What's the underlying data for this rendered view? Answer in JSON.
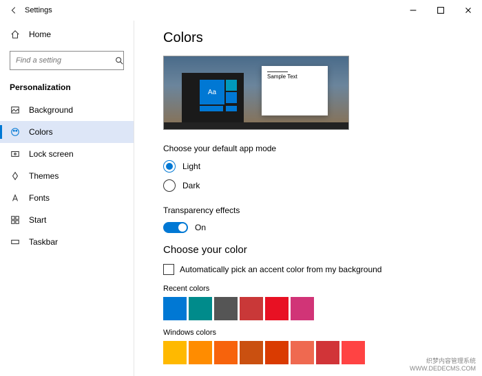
{
  "window": {
    "app_title": "Settings"
  },
  "sidebar": {
    "home_label": "Home",
    "search_placeholder": "Find a setting",
    "category": "Personalization",
    "items": [
      {
        "label": "Background"
      },
      {
        "label": "Colors"
      },
      {
        "label": "Lock screen"
      },
      {
        "label": "Themes"
      },
      {
        "label": "Fonts"
      },
      {
        "label": "Start"
      },
      {
        "label": "Taskbar"
      }
    ]
  },
  "main": {
    "title": "Colors",
    "preview": {
      "sample_text": "Sample Text",
      "tile_text": "Aa"
    },
    "mode_label": "Choose your default app mode",
    "mode_light": "Light",
    "mode_dark": "Dark",
    "transparency_label": "Transparency effects",
    "transparency_state": "On",
    "choose_color_title": "Choose your color",
    "auto_pick_label": "Automatically pick an accent color from my background",
    "recent_label": "Recent colors",
    "recent_colors": [
      "#0078d4",
      "#008b8b",
      "#555555",
      "#c93838",
      "#e81123",
      "#d13477"
    ],
    "windows_label": "Windows colors",
    "windows_colors": [
      "#ffb900",
      "#ff8c00",
      "#f7630c",
      "#ca5010",
      "#da3b01",
      "#ef6950",
      "#d13438",
      "#ff4343"
    ]
  },
  "watermark": {
    "line1": "织梦内容管理系统",
    "line2": "WWW.DEDECMS.COM"
  }
}
